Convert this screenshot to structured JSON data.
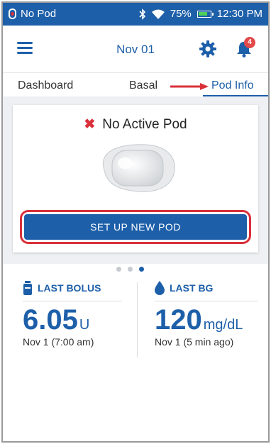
{
  "status_bar": {
    "pod_status": "No Pod",
    "battery_percent": "75%",
    "time": "12:30 PM"
  },
  "header": {
    "date": "Nov 01",
    "notification_count": "4"
  },
  "tabs": [
    {
      "label": "Dashboard",
      "active": false
    },
    {
      "label": "Basal",
      "active": false
    },
    {
      "label": "Pod Info",
      "active": true
    }
  ],
  "pod_card": {
    "status_icon": "x-icon",
    "status_text": "No Active Pod",
    "setup_button_label": "SET UP NEW POD"
  },
  "pager": {
    "pages": 3,
    "active_index": 2
  },
  "last_bolus": {
    "title": "LAST BOLUS",
    "value": "6.05",
    "unit": "U",
    "time": "Nov 1 (7:00 am)"
  },
  "last_bg": {
    "title": "LAST BG",
    "value": "120",
    "unit": "mg/dL",
    "time": "Nov 1 (5 min ago)"
  },
  "colors": {
    "primary": "#1d5fa9",
    "alert": "#d9303a",
    "battery": "#4fd05a"
  }
}
